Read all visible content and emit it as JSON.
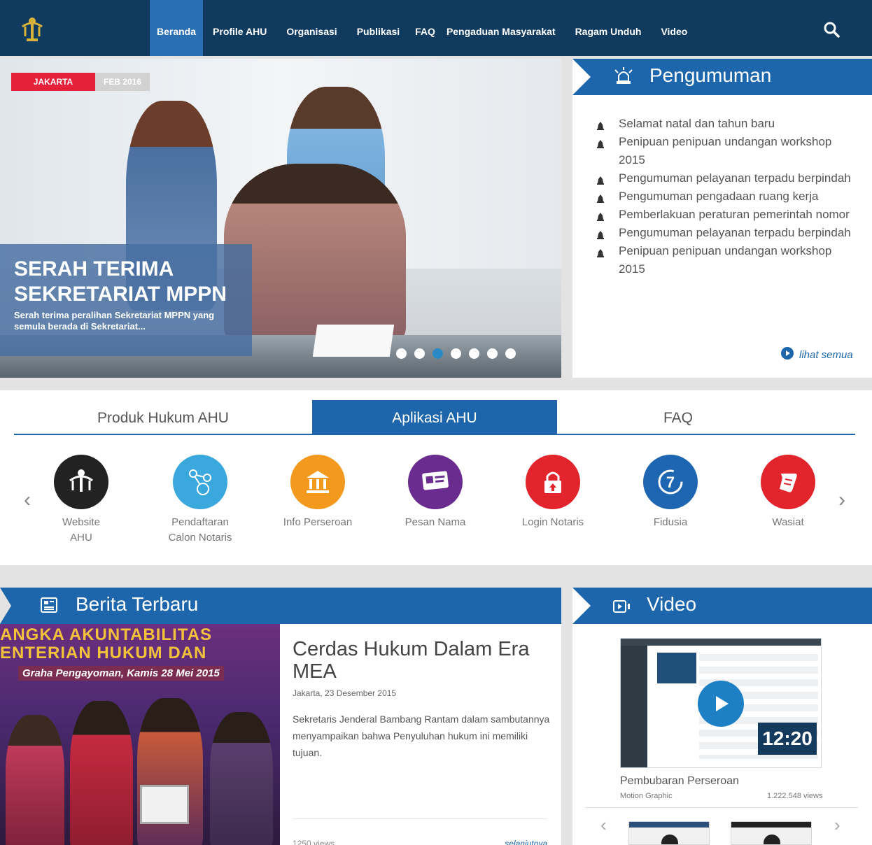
{
  "nav": {
    "items": [
      "Beranda",
      "Profile AHU",
      "Organisasi",
      "Publikasi",
      "FAQ",
      "Pengaduan Masyarakat",
      "Ragam Unduh",
      "Video"
    ]
  },
  "hero": {
    "city": "JAKARTA",
    "date": "FEB 2016",
    "title": "SERAH TERIMA SEKRETARIAT MPPN",
    "subtitle": "Serah terima peralihan Sekretariat MPPN yang semula berada di Sekretariat...",
    "slide_count": 7,
    "active_slide": 3
  },
  "pengumuman": {
    "title": "Pengumuman",
    "items": [
      "Selamat natal dan tahun baru",
      "Penipuan penipuan undangan workshop 2015",
      "Pengumuman pelayanan terpadu berpindah",
      "Pengumuman pengadaan ruang kerja",
      "Pemberlakuan peraturan pemerintah nomor",
      "Pengumuman pelayanan terpadu berpindah",
      "Penipuan penipuan undangan workshop 2015"
    ],
    "more": "lihat semua"
  },
  "apps": {
    "tabs": [
      "Produk Hukum AHU",
      "Aplikasi AHU",
      "FAQ"
    ],
    "active_tab": 1,
    "items": [
      {
        "label": "Website\nAHU",
        "color": "#222222",
        "icon": "pengayoman-logo-icon"
      },
      {
        "label": "Pendaftaran\nCalon Notaris",
        "color": "#3aa7dd",
        "icon": "network-icon"
      },
      {
        "label": "Info Perseroan",
        "color": "#f39a1e",
        "icon": "bank-icon"
      },
      {
        "label": "Pesan Nama",
        "color": "#6a2c8f",
        "icon": "id-card-icon"
      },
      {
        "label": "Login Notaris",
        "color": "#e2242c",
        "icon": "lock-icon"
      },
      {
        "label": "Fidusia",
        "color": "#1e66b1",
        "icon": "clock-7-icon"
      },
      {
        "label": "Wasiat",
        "color": "#e2242c",
        "icon": "scroll-icon"
      }
    ]
  },
  "berita": {
    "title": "Berita Terbaru",
    "image_text_1": "ANGKA AKUNTABILITAS",
    "image_text_2": "ENTERIAN HUKUM DAN",
    "image_text_3": "Graha Pengayoman, Kamis 28 Mei 2015",
    "headline": "Cerdas Hukum Dalam Era MEA",
    "date": "Jakarta, 23 Desember 2015",
    "text": "Sekretaris Jenderal Bambang Rantam dalam sambutannya menyampaikan bahwa Penyuluhan hukum ini memiliki tujuan.",
    "views": "1250 views",
    "more": "selanjutnya"
  },
  "video": {
    "title": "Video",
    "duration": "12:20",
    "video_title": "Pembubaran Perseroan",
    "category": "Motion Graphic",
    "views": "1.222.548 views"
  },
  "colors": {
    "nav": "#103a5e",
    "accent": "#1d66ab",
    "tag_red": "#e5213a"
  }
}
